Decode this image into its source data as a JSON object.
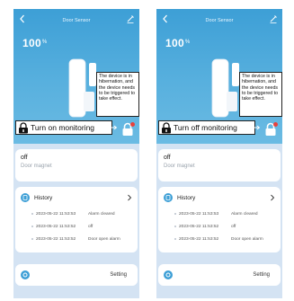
{
  "screens": [
    {
      "nav_title": "Door Sensor",
      "battery_value": "100",
      "battery_unit": "%",
      "bubble_text": "The device is in hibernation, and the device needs to be triggered to take effect.",
      "monitor_label": "Turn on monitoring",
      "state_value": "off",
      "state_type": "Door magnet",
      "history_title": "History",
      "events": [
        {
          "time": "2023-05-22 11:53:53",
          "desc": "Alarm cleared"
        },
        {
          "time": "2023-05-22 11:53:52",
          "desc": "off"
        },
        {
          "time": "2023-05-22 11:53:52",
          "desc": "Door open alarm"
        }
      ],
      "setting_label": "Setting"
    },
    {
      "nav_title": "Door Sensor",
      "battery_value": "100",
      "battery_unit": "%",
      "bubble_text": "The device is in hibernation, and the device needs to be triggered to take effect.",
      "monitor_label": "Turn off monitoring",
      "state_value": "off",
      "state_type": "Door magnet",
      "history_title": "History",
      "events": [
        {
          "time": "2023-05-22 11:53:53",
          "desc": "Alarm cleared"
        },
        {
          "time": "2023-05-22 11:53:52",
          "desc": "off"
        },
        {
          "time": "2023-05-22 11:53:52",
          "desc": "Door open alarm"
        }
      ],
      "setting_label": "Setting"
    }
  ],
  "icons": {
    "back": "back-icon",
    "edit": "edit-icon",
    "lock": "lock-icon",
    "history": "history-icon",
    "chevron": "chevron-right-icon",
    "setting": "settings-icon"
  },
  "colors": {
    "hero_top": "#3d9fd6",
    "hero_bottom": "#6bbbe3",
    "background": "#d4e3f3",
    "lock_button": "#ffffff",
    "alert_dot": "#e8413c",
    "accent": "#3d9fd6"
  }
}
